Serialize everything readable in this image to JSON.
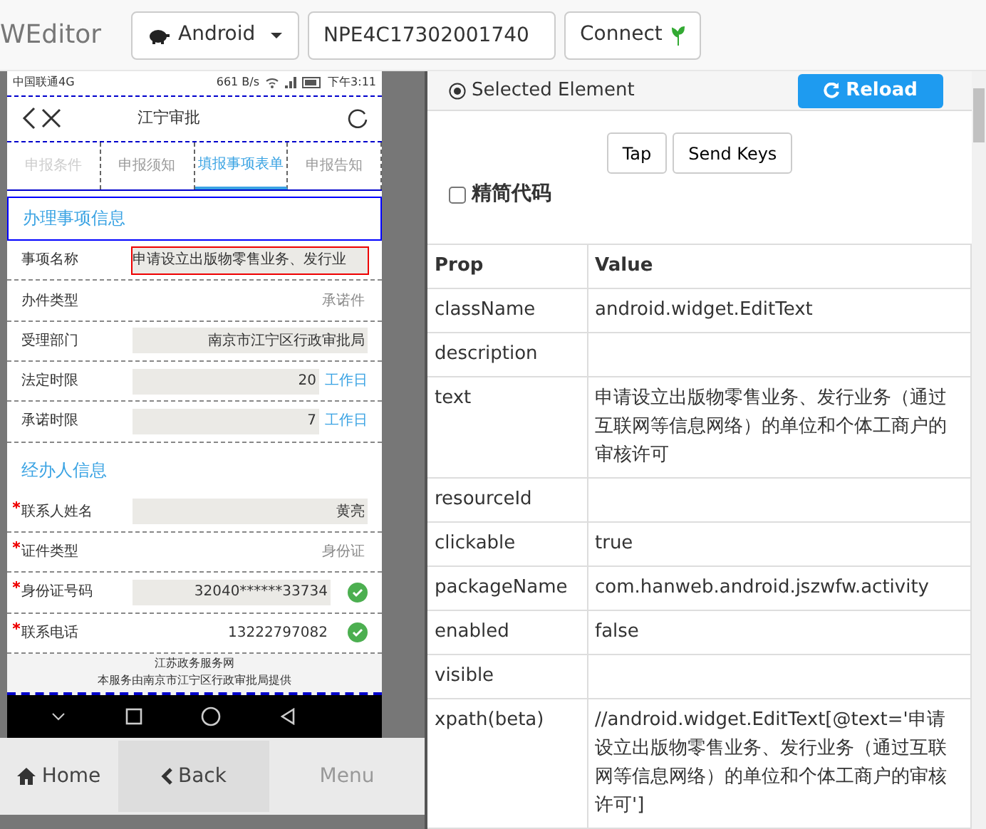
{
  "app": {
    "title": "WEditor"
  },
  "toolbar": {
    "platform": "Android",
    "serial": "NPE4C17302001740",
    "connect": "Connect"
  },
  "device": {
    "status_bar": {
      "carrier": "中国联通4G",
      "speed": "661 B/s",
      "time": "下午3:11"
    },
    "header": {
      "title": "江宁审批"
    },
    "tabs": [
      {
        "label": "申报条件",
        "selected": false,
        "disabled": true
      },
      {
        "label": "申报须知",
        "selected": false,
        "disabled": false
      },
      {
        "label": "填报事项表单",
        "selected": true,
        "disabled": false
      },
      {
        "label": "申报告知",
        "selected": false,
        "disabled": false
      }
    ],
    "sections": [
      {
        "title": "办理事项信息",
        "selected": true,
        "rows": [
          {
            "label": "事项名称",
            "value": "申请设立出版物零售业务、发行业",
            "filled": true,
            "required": false,
            "verified": false,
            "selected": true
          },
          {
            "label": "办件类型",
            "value": "承诺件",
            "filled": false,
            "required": false,
            "verified": false,
            "selected": false
          },
          {
            "label": "受理部门",
            "value": "南京市江宁区行政审批局",
            "filled": true,
            "required": false,
            "verified": false,
            "selected": false
          },
          {
            "label": "法定时限",
            "value": "20",
            "unit": "工作日",
            "filled": true,
            "required": false,
            "verified": false,
            "selected": false
          },
          {
            "label": "承诺时限",
            "value": "7",
            "unit": "工作日",
            "filled": true,
            "required": false,
            "verified": false,
            "selected": false
          }
        ]
      },
      {
        "title": "经办人信息",
        "selected": false,
        "rows": [
          {
            "label": "联系人姓名",
            "value": "黄亮",
            "filled": true,
            "required": true,
            "verified": false,
            "selected": false
          },
          {
            "label": "证件类型",
            "value": "身份证",
            "filled": false,
            "required": true,
            "verified": false,
            "selected": false
          },
          {
            "label": "身份证号码",
            "value": "32040******33734",
            "filled": true,
            "required": true,
            "verified": true,
            "selected": false
          },
          {
            "label": "联系电话",
            "value": "13222797082",
            "filled": false,
            "required": true,
            "verified": true,
            "selected": false
          }
        ]
      }
    ],
    "footer": [
      "江苏政务服务网",
      "本服务由南京市江宁区行政审批局提供"
    ]
  },
  "nav_buttons": [
    {
      "kind": "home",
      "label": "Home",
      "disabled": false
    },
    {
      "kind": "back",
      "label": "Back",
      "disabled": false
    },
    {
      "kind": "menu",
      "label": "Menu",
      "disabled": true
    }
  ],
  "inspector": {
    "title": "Selected Element",
    "reload": "Reload",
    "actions": [
      "Tap",
      "Send Keys"
    ],
    "compact": {
      "label": "精简代码",
      "checked": false
    },
    "table": {
      "columns": [
        "Prop",
        "Value"
      ],
      "rows": [
        {
          "prop": "className",
          "value": "android.widget.EditText"
        },
        {
          "prop": "description",
          "value": ""
        },
        {
          "prop": "text",
          "value": "申请设立出版物零售业务、发行业务（通过互联网等信息网络）的单位和个体工商户的审核许可"
        },
        {
          "prop": "resourceId",
          "value": ""
        },
        {
          "prop": "clickable",
          "value": "true"
        },
        {
          "prop": "packageName",
          "value": "com.hanweb.android.jszwfw.activity"
        },
        {
          "prop": "enabled",
          "value": "false"
        },
        {
          "prop": "visible",
          "value": ""
        },
        {
          "prop": "xpath(beta)",
          "value": "//android.widget.EditText[@text='申请设立出版物零售业务、发行业务（通过互联网等信息网络）的单位和个体工商户的审核许可']"
        }
      ]
    }
  }
}
